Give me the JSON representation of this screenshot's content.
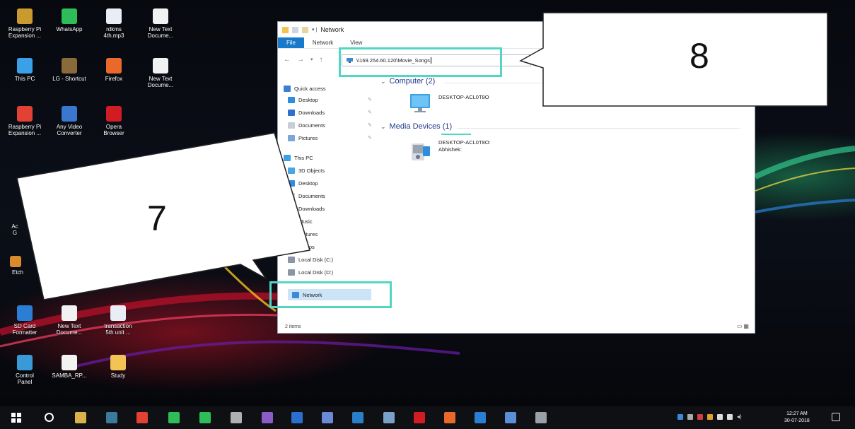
{
  "desktop": {
    "icons": [
      {
        "label": "Raspberry Pi\nExpansion ...",
        "icon": "book-icon",
        "color": "#c99a2e"
      },
      {
        "label": "WhatsApp",
        "icon": "whatsapp-icon",
        "color": "#2ebd59"
      },
      {
        "label": "rdkms\n4th.mp3",
        "icon": "audio-file-icon",
        "color": "#e8edf6"
      },
      {
        "label": "New Text\nDocume...",
        "icon": "text-file-icon",
        "color": "#f2f2f2"
      },
      {
        "label": "This PC",
        "icon": "this-pc-icon",
        "color": "#3aa0e8"
      },
      {
        "label": "LG - Shortcut",
        "icon": "shortcut-icon",
        "color": "#8a6a3a"
      },
      {
        "label": "Firefox",
        "icon": "firefox-icon",
        "color": "#e8692a"
      },
      {
        "label": "New Text\nDocume...",
        "icon": "text-file-icon",
        "color": "#f2f2f2"
      },
      {
        "label": "Raspberry Pi\nExpansion ...",
        "icon": "chrome-icon",
        "color": "#e34133"
      },
      {
        "label": "Any Video\nConverter",
        "icon": "video-converter-icon",
        "color": "#3a78d0"
      },
      {
        "label": "Opera\nBrowser",
        "icon": "opera-icon",
        "color": "#d01c22"
      },
      {
        "label": "SD Card\nFormatter",
        "icon": "sd-card-icon",
        "color": "#2a7fd4"
      },
      {
        "label": "New Text\nDocume...",
        "icon": "text-file-icon",
        "color": "#f2f2f2"
      },
      {
        "label": "transaction\n5th unit ...",
        "icon": "document-icon",
        "color": "#e8edf6"
      },
      {
        "label": "Control\nPanel",
        "icon": "control-panel-icon",
        "color": "#3a9ad8"
      },
      {
        "label": "SAMBA_RP...",
        "icon": "text-file-icon",
        "color": "#f2f2f2"
      },
      {
        "label": "Study",
        "icon": "folder-icon",
        "color": "#f1c453"
      }
    ],
    "partial_labels": [
      "Ac",
      "G",
      "Etch"
    ]
  },
  "explorer": {
    "title": "Network",
    "ribbon_tabs": [
      "File",
      "Network",
      "View"
    ],
    "address": "\\\\169.254.60.120\\Movie_Songs",
    "nav_items": [
      {
        "label": "Quick access",
        "icon": "star-icon",
        "color": "#3b7fd1",
        "pinned": false
      },
      {
        "label": "Desktop",
        "icon": "desktop-icon",
        "color": "#2f8de0",
        "pinned": true
      },
      {
        "label": "Downloads",
        "icon": "downloads-icon",
        "color": "#2f6fd0",
        "pinned": true
      },
      {
        "label": "Documents",
        "icon": "documents-icon",
        "color": "#c8ced6",
        "pinned": true
      },
      {
        "label": "Pictures",
        "icon": "pictures-icon",
        "color": "#7aa7d8",
        "pinned": true
      },
      {
        "label": "This PC",
        "icon": "this-pc-icon",
        "color": "#3aa0e8",
        "pinned": false
      },
      {
        "label": "3D Objects",
        "icon": "3d-objects-icon",
        "color": "#4aa6e0",
        "pinned": false
      },
      {
        "label": "Desktop",
        "icon": "desktop-icon",
        "color": "#2f8de0",
        "pinned": false
      },
      {
        "label": "Documents",
        "icon": "documents-icon",
        "color": "#c8ced6",
        "pinned": false
      },
      {
        "label": "Downloads",
        "icon": "downloads-icon",
        "color": "#2f6fd0",
        "pinned": false
      },
      {
        "label": "Music",
        "icon": "music-icon",
        "color": "#5a8fd8",
        "pinned": false
      },
      {
        "label": "Pictures",
        "icon": "pictures-icon",
        "color": "#7aa7d8",
        "pinned": false
      },
      {
        "label": "Videos",
        "icon": "videos-icon",
        "color": "#6b7fd0",
        "pinned": false
      },
      {
        "label": "Local Disk (C:)",
        "icon": "drive-icon",
        "color": "#8b95a3",
        "pinned": false
      },
      {
        "label": "Local Disk (D:)",
        "icon": "drive-icon",
        "color": "#8b95a3",
        "pinned": false
      },
      {
        "label": "Network",
        "icon": "network-icon",
        "color": "#3a8ad8",
        "pinned": false,
        "selected": true
      }
    ],
    "groups": {
      "computer": {
        "header": "Computer (2)",
        "items": [
          {
            "name": "DESKTOP-ACL0T8O",
            "sub": ""
          }
        ]
      },
      "media": {
        "header": "Media Devices (1)",
        "items": [
          {
            "name": "DESKTOP-ACL0T8O:",
            "sub": "Abhishek:"
          }
        ]
      }
    },
    "status": "2 items"
  },
  "callouts": {
    "seven": "7",
    "eight": "8"
  },
  "taskbar": {
    "clock_time": "12:27 AM",
    "clock_date": "30-07-2018"
  }
}
